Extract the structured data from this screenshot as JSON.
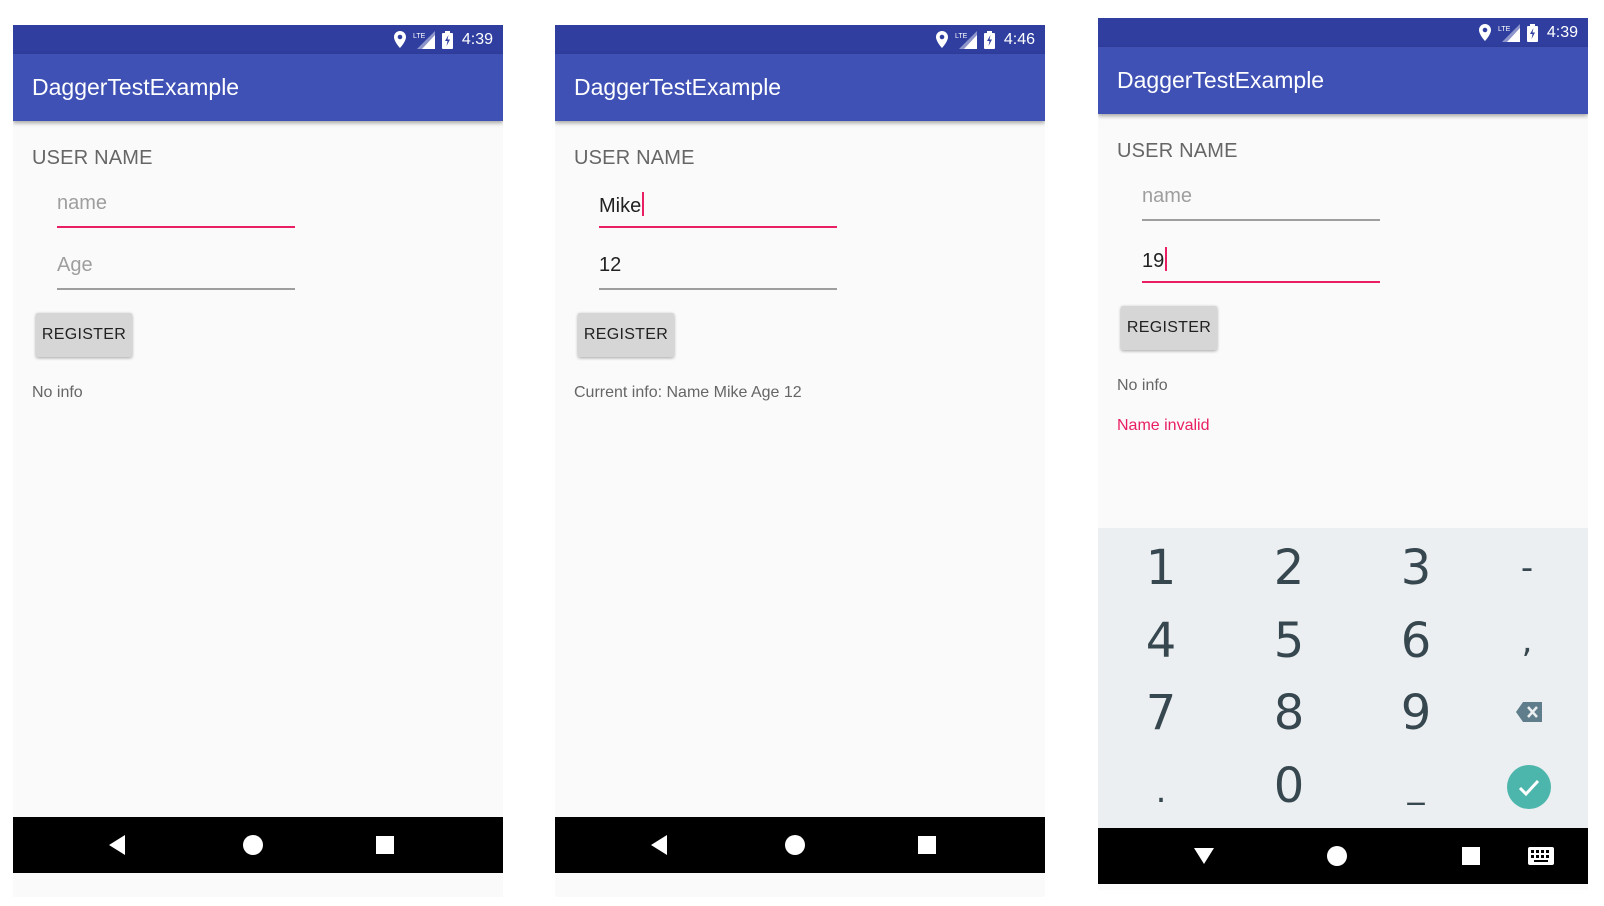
{
  "screens": [
    {
      "status_time": "4:39",
      "app_title": "DaggerTestExample",
      "section_label": "USER NAME",
      "name_field": {
        "value": "",
        "placeholder": "name"
      },
      "age_field": {
        "value": "",
        "placeholder": "Age"
      },
      "register_label": "REGISTER",
      "info_text": "No info"
    },
    {
      "status_time": "4:46",
      "app_title": "DaggerTestExample",
      "section_label": "USER NAME",
      "name_field": {
        "value": "Mike",
        "placeholder": "name"
      },
      "age_field": {
        "value": "12",
        "placeholder": "Age"
      },
      "register_label": "REGISTER",
      "info_text": "Current info: Name Mike Age 12"
    },
    {
      "status_time": "4:39",
      "app_title": "DaggerTestExample",
      "section_label": "USER NAME",
      "name_field": {
        "value": "",
        "placeholder": "name"
      },
      "age_field": {
        "value": "19",
        "placeholder": "Age"
      },
      "register_label": "REGISTER",
      "info_text": "No info",
      "error_text": "Name invalid",
      "keyboard": {
        "keys": [
          "1",
          "2",
          "3",
          "-",
          "4",
          "5",
          "6",
          ",",
          "7",
          "8",
          "9",
          ".",
          "0",
          "_"
        ],
        "icons": [
          "backspace-icon",
          "done-check-icon"
        ]
      }
    }
  ],
  "status_icons": [
    "location-icon",
    "lte-signal-icon",
    "battery-charging-icon"
  ],
  "nav_icons": [
    "back-icon",
    "home-icon",
    "recents-icon",
    "keyboard-switch-icon"
  ],
  "colors": {
    "status_bar": "#303f9f",
    "app_bar": "#3f51b5",
    "accent": "#e91e63",
    "background": "#fafafa",
    "keyboard_bg": "#eceff1",
    "done_key": "#4db6ac"
  }
}
